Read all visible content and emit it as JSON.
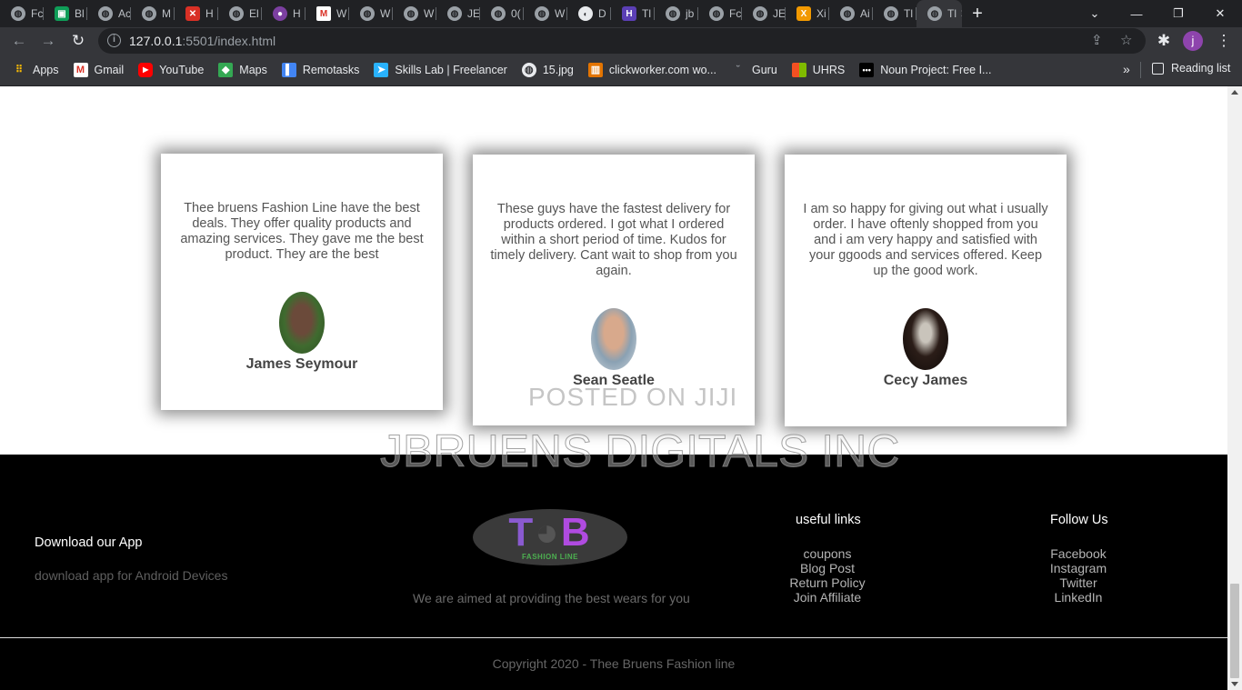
{
  "browser": {
    "tabs": [
      {
        "label": "Fc",
        "icon": "globe-icon"
      },
      {
        "label": "Bl",
        "icon": "app-icon-green"
      },
      {
        "label": "Ac",
        "icon": "globe-icon"
      },
      {
        "label": "M",
        "icon": "globe-icon"
      },
      {
        "label": "H",
        "icon": "red-x-icon"
      },
      {
        "label": "El",
        "icon": "globe-icon"
      },
      {
        "label": "H",
        "icon": "circle-icon"
      },
      {
        "label": "W",
        "icon": "gmail-icon"
      },
      {
        "label": "W",
        "icon": "globe-icon"
      },
      {
        "label": "W",
        "icon": "globe-icon"
      },
      {
        "label": "JE",
        "icon": "globe-icon"
      },
      {
        "label": "0(",
        "icon": "globe-icon"
      },
      {
        "label": "W",
        "icon": "globe-icon"
      },
      {
        "label": "D",
        "icon": "toggle-icon"
      },
      {
        "label": "Tl",
        "icon": "purple-h-icon"
      },
      {
        "label": "jb",
        "icon": "globe-icon"
      },
      {
        "label": "Fc",
        "icon": "globe-icon"
      },
      {
        "label": "JE",
        "icon": "globe-icon"
      },
      {
        "label": "Xi",
        "icon": "x-logo-icon"
      },
      {
        "label": "Ai",
        "icon": "globe-icon"
      },
      {
        "label": "Tl",
        "icon": "globe-icon"
      },
      {
        "label": "Tl",
        "icon": "globe-icon"
      }
    ],
    "url_host": "127.0.0.1",
    "url_rest": ":5501/index.html",
    "profile_initial": "j",
    "bookmarks": [
      {
        "label": "Apps",
        "icon": "apps-grid-icon"
      },
      {
        "label": "Gmail",
        "icon": "gmail-icon"
      },
      {
        "label": "YouTube",
        "icon": "youtube-icon"
      },
      {
        "label": "Maps",
        "icon": "maps-icon"
      },
      {
        "label": "Remotasks",
        "icon": "remotasks-icon"
      },
      {
        "label": "Skills Lab | Freelancer",
        "icon": "freelancer-icon"
      },
      {
        "label": "15.jpg",
        "icon": "globe-icon"
      },
      {
        "label": "clickworker.com wo...",
        "icon": "clickworker-icon"
      },
      {
        "label": "Guru",
        "icon": "guru-icon"
      },
      {
        "label": "UHRS",
        "icon": "uhrs-icon"
      },
      {
        "label": "Noun Project: Free I...",
        "icon": "noun-project-icon"
      }
    ],
    "bookmarks_more": "»",
    "reading_list": "Reading list"
  },
  "testimonials": [
    {
      "quote": "Thee bruens Fashion Line have the best deals. They offer quality products and amazing services. They gave me the best product. They are the best",
      "name": "James Seymour"
    },
    {
      "quote": "These guys have the fastest delivery for products ordered. I got what I ordered within a short period of time. Kudos for timely delivery. Cant wait to shop from you again.",
      "name": "Sean Seatle"
    },
    {
      "quote": "I am so happy for giving out what i usually order. I have oftenly shopped from you and i am very happy and satisfied with your ggoods and services offered. Keep up the good work.",
      "name": "Cecy James"
    }
  ],
  "watermarks": {
    "line1": "POSTED ON JIJI",
    "line2": "JBRUENS DIGITALS INC"
  },
  "footer": {
    "app": {
      "title": "Download our App",
      "text": "download app for Android Devices"
    },
    "brand": {
      "logo_letters": [
        "T",
        "B"
      ],
      "logo_sub": "FASHION LINE",
      "tagline": "We are aimed at providing the best wears for you"
    },
    "useful": {
      "title": "useful links",
      "links": [
        "coupons",
        "Blog Post",
        "Return Policy",
        "Join Affiliate"
      ]
    },
    "follow": {
      "title": "Follow Us",
      "links": [
        "Facebook",
        "Instagram",
        "Twitter",
        "LinkedIn"
      ]
    },
    "copyright": "Copyright 2020 - Thee Bruens Fashion line"
  }
}
